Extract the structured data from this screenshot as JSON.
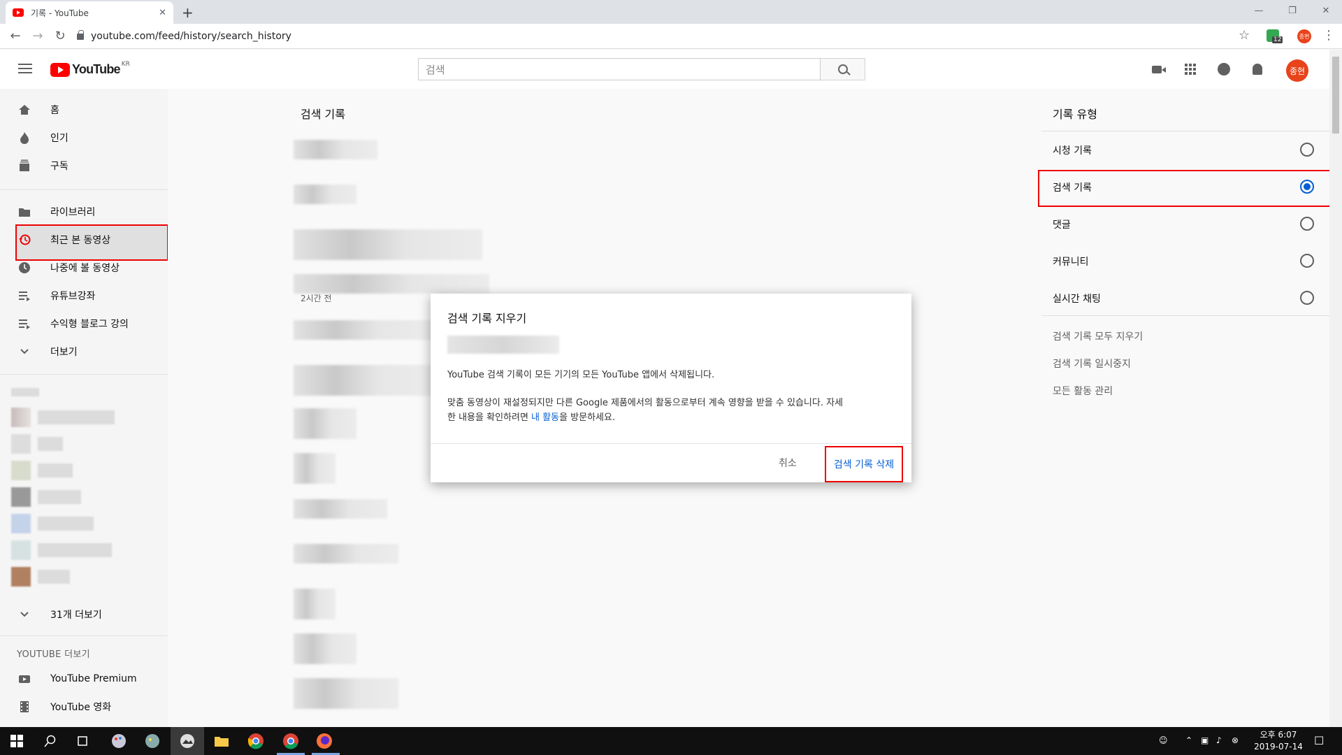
{
  "browser": {
    "tab_title": "기록 - YouTube",
    "tab_close": "✕",
    "new_tab": "+",
    "url": "youtube.com/feed/history/search_history",
    "ext_badge": "12",
    "profile_initials": "종현"
  },
  "masthead": {
    "logo_text": "YouTube",
    "logo_region": "KR",
    "search_placeholder": "검색",
    "avatar_initials": "종현"
  },
  "guide": {
    "items": [
      {
        "label": "홈",
        "icon": "home-icon"
      },
      {
        "label": "인기",
        "icon": "fire-icon"
      },
      {
        "label": "구독",
        "icon": "subscriptions-icon"
      },
      {
        "label": "라이브러리",
        "icon": "library-icon"
      },
      {
        "label": "최근 본 동영상",
        "icon": "history-icon"
      },
      {
        "label": "나중에 볼 동영상",
        "icon": "clock-icon"
      },
      {
        "label": "유튜브강좌",
        "icon": "playlist-icon"
      },
      {
        "label": "수익형 블로그 강의",
        "icon": "playlist-icon"
      },
      {
        "label": "더보기",
        "icon": "chevron-down-icon"
      }
    ],
    "more_subscriptions": "31개 더보기",
    "section_title": "YOUTUBE 더보기",
    "extra_items": [
      {
        "label": "YouTube Premium",
        "icon": "premium-icon"
      },
      {
        "label": "YouTube 영화",
        "icon": "film-icon"
      }
    ]
  },
  "main": {
    "title": "검색 기록",
    "time_label": "2시간 전",
    "remove_icon": "✕"
  },
  "history_type": {
    "title": "기록 유형",
    "options": [
      {
        "label": "시청 기록",
        "selected": false
      },
      {
        "label": "검색 기록",
        "selected": true
      },
      {
        "label": "댓글",
        "selected": false
      },
      {
        "label": "커뮤니티",
        "selected": false
      },
      {
        "label": "실시간 채팅",
        "selected": false
      }
    ],
    "links": [
      "검색 기록 모두 지우기",
      "검색 기록 일시중지",
      "모든 활동 관리"
    ]
  },
  "dialog": {
    "title": "검색 기록 지우기",
    "line1": "YouTube 검색 기록이 모든 기기의 모든 YouTube 앱에서 삭제됩니다.",
    "line2a": "맞춤 동영상이 재설정되지만 다른 Google 제품에서의 활동으로부터 계속 영향을 받을 수 있습니다. 자세",
    "line2b_pre": "한 내용을 확인하려면 ",
    "line2b_link": "내 활동",
    "line2b_post": "을 방문하세요.",
    "cancel": "취소",
    "confirm": "검색 기록 삭제"
  },
  "taskbar": {
    "time": "오후 6:07",
    "date": "2019-07-14"
  },
  "colors": {
    "accent_blue": "#065fd4",
    "highlight_red": "#ee0000",
    "brand_red": "#ff0000"
  }
}
